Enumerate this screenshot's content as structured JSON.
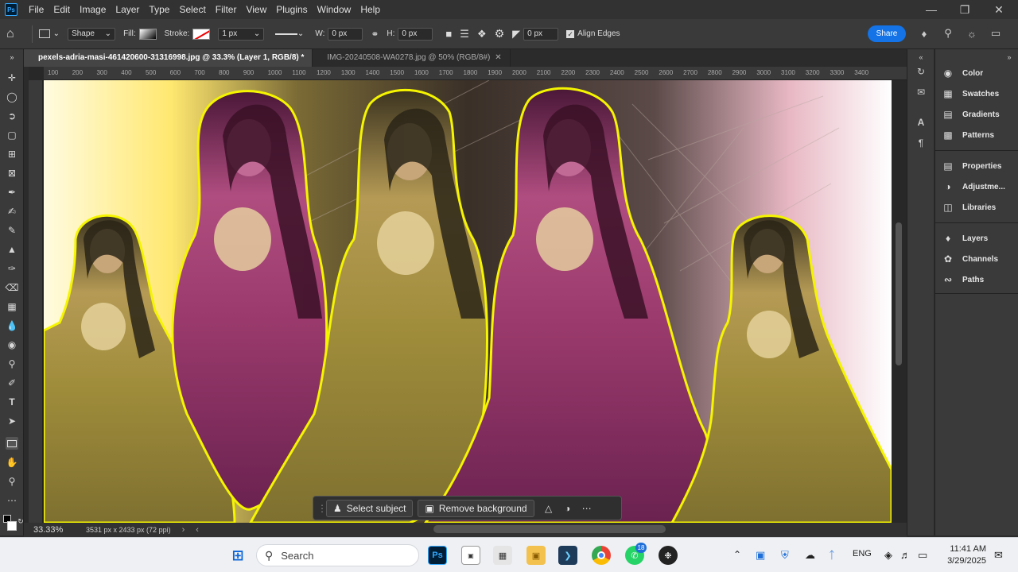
{
  "app": {
    "logo": "Ps",
    "menus": [
      "File",
      "Edit",
      "Image",
      "Layer",
      "Type",
      "Select",
      "Filter",
      "View",
      "Plugins",
      "Window",
      "Help"
    ]
  },
  "options": {
    "shape_mode": "Shape",
    "fill_label": "Fill:",
    "stroke_label": "Stroke:",
    "stroke_width": "1 px",
    "w_label": "W:",
    "w_value": "0 px",
    "h_label": "H:",
    "h_value": "0 px",
    "radius_value": "0 px",
    "align_edges": "Align Edges",
    "share": "Share"
  },
  "tabs": [
    {
      "label": "pexels-adria-masi-461420600-31316998.jpg @ 33.3% (Layer 1, RGB/8) *",
      "active": true
    },
    {
      "label": "IMG-20240508-WA0278.jpg @ 50% (RGB/8#)",
      "active": false
    }
  ],
  "ruler": {
    "ticks": [
      "100",
      "200",
      "300",
      "400",
      "500",
      "600",
      "700",
      "800",
      "900",
      "1000",
      "1100",
      "1200",
      "1300",
      "1400",
      "1500",
      "1600",
      "1700",
      "1800",
      "1900",
      "2000",
      "2100",
      "2200",
      "2300",
      "2400",
      "2500",
      "2600",
      "2700",
      "2800",
      "2900",
      "3000",
      "3100",
      "3200",
      "3300",
      "3400"
    ]
  },
  "context_bar": {
    "select_subject": "Select subject",
    "remove_background": "Remove background"
  },
  "status": {
    "zoom": "33.33%",
    "doc_info": "3531 px x 2433 px (72 ppi)"
  },
  "panels": {
    "group1": [
      "Color",
      "Swatches",
      "Gradients",
      "Patterns"
    ],
    "group2": [
      "Properties",
      "Adjustme...",
      "Libraries"
    ],
    "group3": [
      "Layers",
      "Channels",
      "Paths"
    ]
  },
  "taskbar": {
    "search_placeholder": "Search",
    "whatsapp_badge": "18",
    "lang": "ENG",
    "time": "11:41 AM",
    "date": "3/29/2025"
  },
  "colors": {
    "accent": "#1473e6",
    "selection_outline": "#f5f500",
    "magenta_tint": "#8a2a5e",
    "gold_tint": "#9c8a2e"
  }
}
